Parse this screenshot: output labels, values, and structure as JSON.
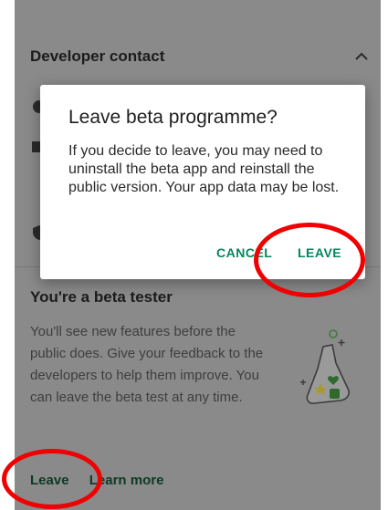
{
  "developer_contact": {
    "title": "Developer contact"
  },
  "dialog": {
    "title": "Leave beta programme?",
    "body": "If you decide to leave, you may need to uninstall the beta app and reinstall the public version. Your app data may be lost.",
    "cancel_label": "CANCEL",
    "leave_label": "LEAVE"
  },
  "beta": {
    "title": "You're a beta tester",
    "body": "You'll see new features before the public does. Give your feedback to the developers to help them improve. You can leave the beta test at any time.",
    "leave_link": "Leave",
    "learn_more_link": "Learn more"
  },
  "colors": {
    "accent": "#01875f",
    "scrim": "#8a8a8a",
    "annotation": "#f00000"
  },
  "icons": [
    "chevron-up-icon",
    "web-icon",
    "email-icon",
    "shield-icon",
    "beta-flask-illustration"
  ]
}
